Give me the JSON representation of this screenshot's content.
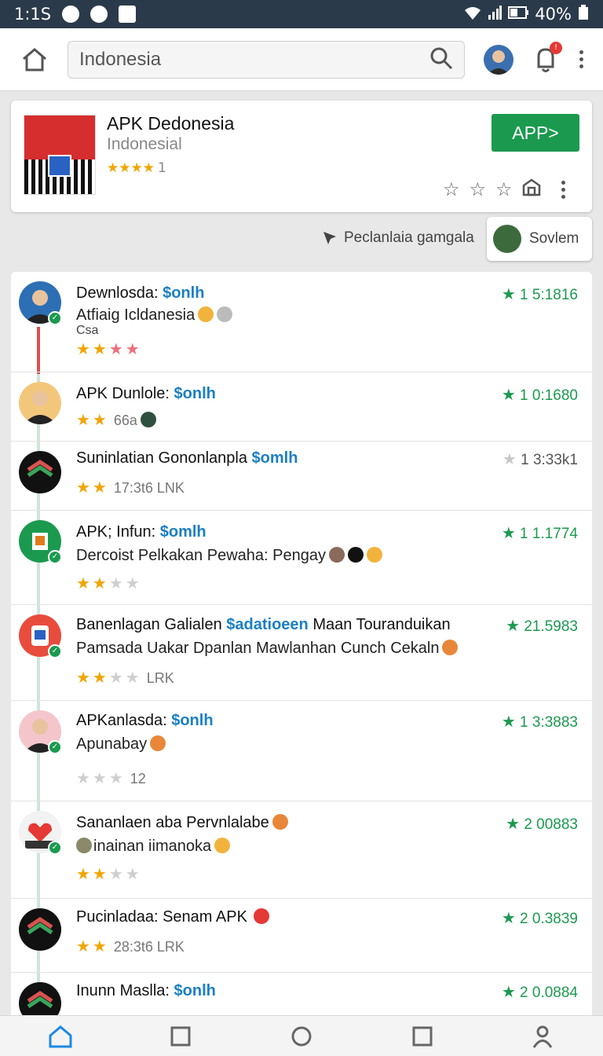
{
  "status": {
    "time": "1:1S",
    "battery": "40%"
  },
  "search": {
    "value": "Indonesia"
  },
  "notifications": {
    "badge": "!"
  },
  "featured": {
    "title": "APK Dedonesia",
    "subtitle": "Indonesial",
    "stars": "★★★★",
    "rating_count": "1",
    "button_label": "APP>"
  },
  "filter": {
    "label": "Peclanlaia gamgala",
    "chip_label": "Sovlem"
  },
  "items": [
    {
      "name": "Dewnlosda:",
      "tag": "$onlh",
      "line2": "Atfiaig  Icldanesia",
      "line3": "Csa",
      "score": "1 5:1816"
    },
    {
      "name": "APK Dunlole:",
      "tag": "$onlh",
      "extra": "66a",
      "score": "1 0:1680"
    },
    {
      "name": "Suninlatian Gononlanpla",
      "tag": "$omlh",
      "extra": "17:3t6   LNK",
      "score": "1 3:33k1"
    },
    {
      "name": "APK; Infun:",
      "tag": "$omlh",
      "line2": "Dercoist Pelkakan Pewaha: Pengay",
      "score": "1 1.1774"
    },
    {
      "name": "Banenlagan Galialen",
      "tag": "$adatioeen",
      "name_rest": "Maan Touranduikan",
      "line2": "Pamsada Uakar Dpanlan Mawlanhan Cunch Cekaln",
      "extra": "LRK",
      "score": "21.5983"
    },
    {
      "name": "APKanlasda:",
      "tag": "$onlh",
      "line2": "Apunabay",
      "extra": "12",
      "score": "1 3:3883"
    },
    {
      "name": "Sananlaen aba Pervnlalabe",
      "line2": "inainan iimanoka",
      "score": "2 00883"
    },
    {
      "name": "Pucinladaa: Senam APK",
      "extra": "28:3t6   LRK",
      "score": "2 0.3839"
    },
    {
      "name": "Inunn Maslla:",
      "tag": "$onlh",
      "score": "2 0.0884"
    }
  ]
}
